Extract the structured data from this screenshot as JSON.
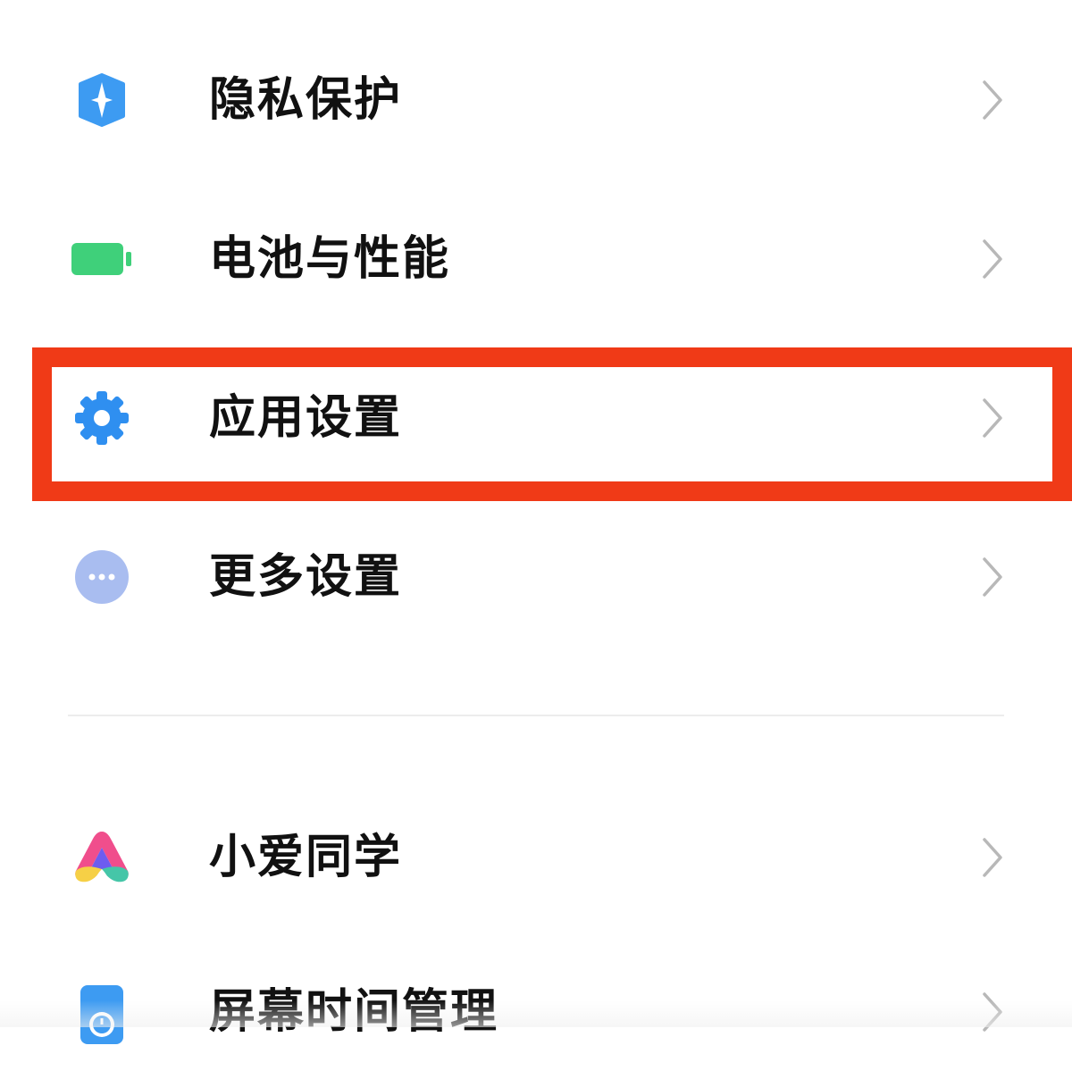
{
  "settings_list": {
    "items": [
      {
        "label": "隐私保护",
        "icon": "privacy-shield-icon"
      },
      {
        "label": "电池与性能",
        "icon": "battery-icon"
      },
      {
        "label": "应用设置",
        "icon": "gear-icon"
      },
      {
        "label": "更多设置",
        "icon": "more-dots-icon"
      },
      {
        "label": "小爱同学",
        "icon": "xiaoai-assistant-icon"
      },
      {
        "label": "屏幕时间管理",
        "icon": "screen-time-icon"
      }
    ],
    "highlighted_index": 2
  },
  "colors": {
    "highlight": "#f03a17",
    "privacy_blue": "#3d9bf2",
    "battery_green": "#3fd07a",
    "gear_blue": "#2f8ff0",
    "more_purple": "#a9bdf0",
    "chevron": "#b8b8b8"
  }
}
